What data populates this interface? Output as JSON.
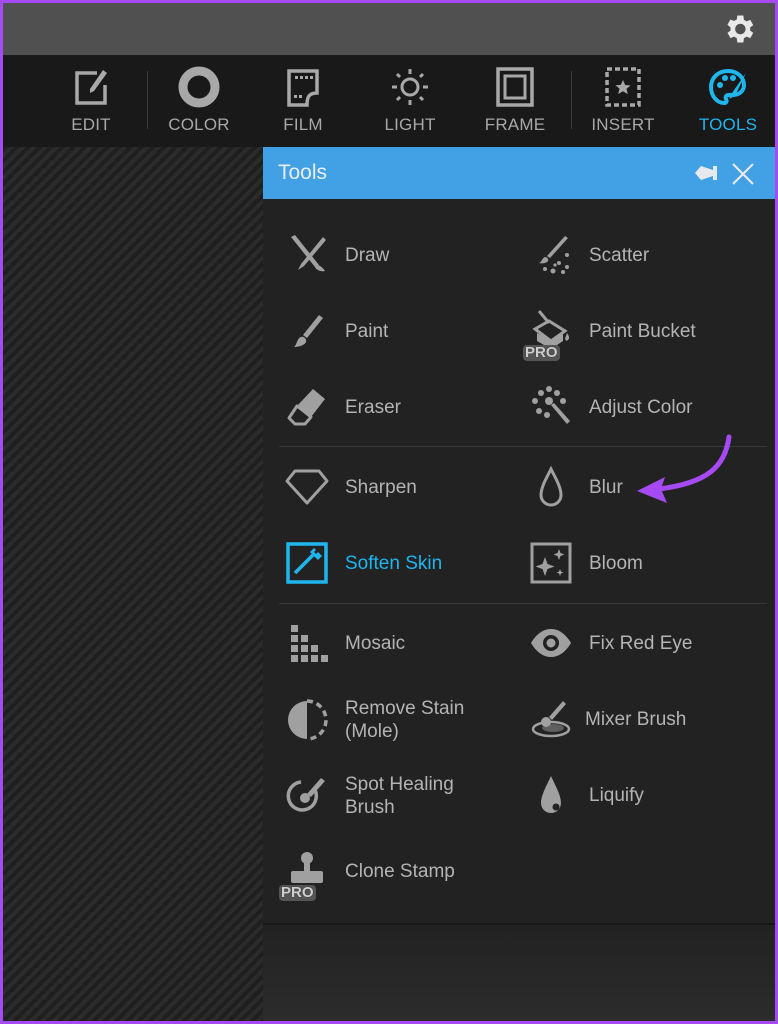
{
  "topbar": {
    "settings_icon": "gear-icon"
  },
  "nav": {
    "items": [
      {
        "label": "EDIT",
        "icon": "edit-icon",
        "active": false
      },
      {
        "label": "COLOR",
        "icon": "color-ring-icon",
        "active": false
      },
      {
        "label": "FILM",
        "icon": "film-icon",
        "active": false
      },
      {
        "label": "LIGHT",
        "icon": "sun-icon",
        "active": false
      },
      {
        "label": "FRAME",
        "icon": "frame-icon",
        "active": false
      },
      {
        "label": "INSERT",
        "icon": "insert-star-icon",
        "active": false
      },
      {
        "label": "TOOLS",
        "icon": "palette-icon",
        "active": true
      }
    ],
    "active_color": "#1fb6ee"
  },
  "panel": {
    "title": "Tools",
    "header_color": "#42a1e4",
    "pin_icon": "pin-icon",
    "close_icon": "close-icon",
    "pro_badge": "PRO",
    "tools": [
      {
        "label": "Draw",
        "icon": "draw-icon"
      },
      {
        "label": "Scatter",
        "icon": "scatter-icon"
      },
      {
        "label": "Paint",
        "icon": "paint-brush-icon"
      },
      {
        "label": "Paint Bucket",
        "icon": "paint-bucket-icon",
        "pro": true
      },
      {
        "label": "Eraser",
        "icon": "eraser-icon"
      },
      {
        "label": "Adjust Color",
        "icon": "adjust-color-icon"
      },
      {
        "label": "Sharpen",
        "icon": "diamond-icon"
      },
      {
        "label": "Blur",
        "icon": "drop-outline-icon"
      },
      {
        "label": "Soften Skin",
        "icon": "soften-skin-icon",
        "active": true
      },
      {
        "label": "Bloom",
        "icon": "bloom-sparkle-icon"
      },
      {
        "label": "Mosaic",
        "icon": "mosaic-icon"
      },
      {
        "label": "Fix Red Eye",
        "icon": "eye-icon"
      },
      {
        "label": "Remove Stain\n(Mole)",
        "icon": "remove-stain-icon"
      },
      {
        "label": "Mixer Brush",
        "icon": "mixer-brush-icon"
      },
      {
        "label": "Spot Healing\nBrush",
        "icon": "spot-healing-icon"
      },
      {
        "label": "Liquify",
        "icon": "liquify-drop-icon"
      },
      {
        "label": "Clone Stamp",
        "icon": "clone-stamp-icon",
        "pro": true
      }
    ]
  },
  "annotation": {
    "arrow_color": "#a64bf4",
    "points_to": "Blur"
  }
}
